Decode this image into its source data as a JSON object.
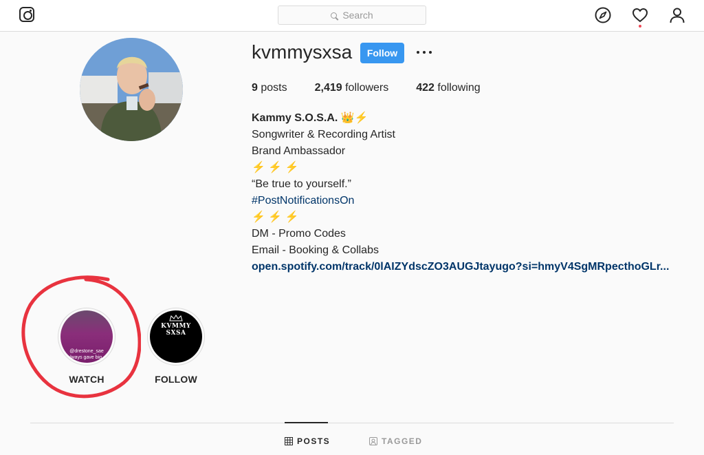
{
  "search": {
    "placeholder": "Search"
  },
  "profile": {
    "username": "kvmmysxsa",
    "follow_label": "Follow",
    "stats": {
      "posts_count": "9",
      "posts_label": "posts",
      "followers_count": "2,419",
      "followers_label": "followers",
      "following_count": "422",
      "following_label": "following"
    },
    "bio": {
      "name": "Kammy S.O.S.A.",
      "name_emoji": "👑",
      "name_bolt": "⚡",
      "line1": "Songwriter & Recording Artist",
      "line2": "Brand Ambassador",
      "bolts": "⚡ ⚡ ⚡",
      "quote": "“Be true to yourself.”",
      "hashtag": "#PostNotificationsOn",
      "bolts2": "⚡ ⚡ ⚡",
      "line3": "DM - Promo Codes",
      "line4": "Email - Booking & Collabs",
      "link": "open.spotify.com/track/0lAIZYdscZO3AUGJtayugo?si=hmyV4SgMRpecthoGLr..."
    }
  },
  "highlights": [
    {
      "label": "WATCH",
      "overlay_line1": "@drestone_sae",
      "overlay_line2": "always gave big..."
    },
    {
      "label": "FOLLOW",
      "brand": "KVMMY SXSA"
    }
  ],
  "tabs": {
    "posts": "POSTS",
    "tagged": "TAGGED"
  },
  "colors": {
    "accent": "#3897f0",
    "link": "#003569",
    "annotation": "#e8333f"
  },
  "icons": [
    "instagram-logo-icon",
    "search-icon",
    "compass-icon",
    "heart-icon",
    "profile-icon",
    "more-icon",
    "grid-icon",
    "tagged-icon"
  ]
}
